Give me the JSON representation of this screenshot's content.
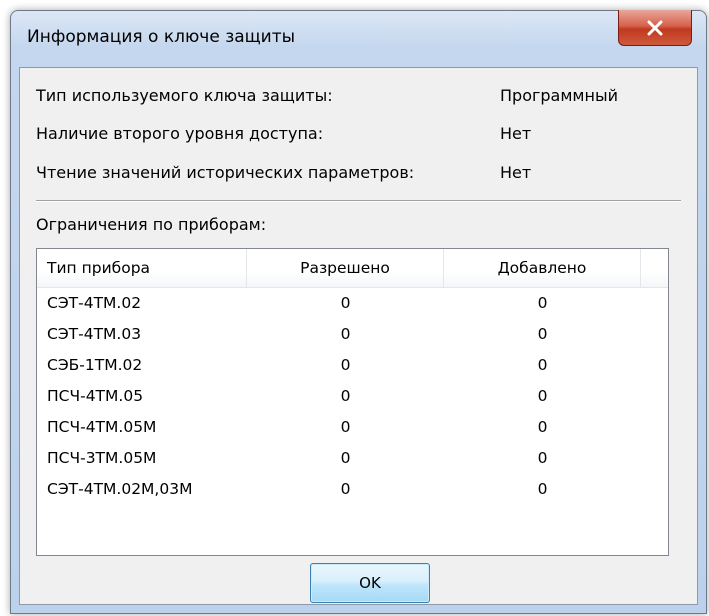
{
  "window": {
    "title": "Информация о ключе защиты",
    "close_glyph": "X",
    "close_color": "#c0391f"
  },
  "info": [
    {
      "label": "Тип используемого ключа защиты:",
      "value": "Программный"
    },
    {
      "label": "Наличие второго уровня доступа:",
      "value": "Нет"
    },
    {
      "label": "Чтение значений исторических параметров:",
      "value": "Нет"
    }
  ],
  "devices": {
    "group_label": "Ограничения по приборам:",
    "columns": [
      "Тип прибора",
      "Разрешено",
      "Добавлено"
    ],
    "rows": [
      [
        "СЭТ-4ТМ.02",
        "0",
        "0"
      ],
      [
        "СЭТ-4ТМ.03",
        "0",
        "0"
      ],
      [
        "СЭБ-1ТМ.02",
        "0",
        "0"
      ],
      [
        "ПСЧ-4ТМ.05",
        "0",
        "0"
      ],
      [
        "ПСЧ-4ТМ.05М",
        "0",
        "0"
      ],
      [
        "ПСЧ-3ТМ.05М",
        "0",
        "0"
      ],
      [
        "СЭТ-4ТМ.02М,03М",
        "0",
        "0"
      ]
    ]
  },
  "buttons": {
    "ok_label": "OK",
    "accent": "#3c7fb1"
  }
}
